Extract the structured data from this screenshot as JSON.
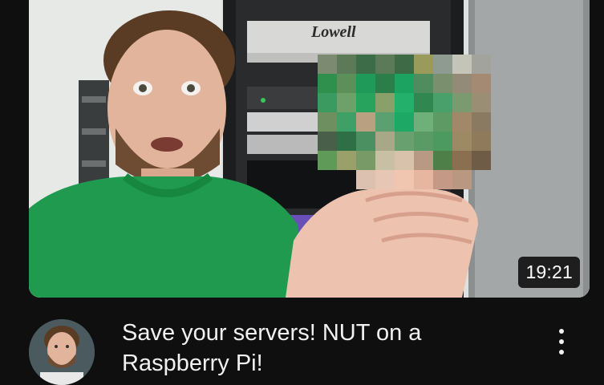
{
  "video": {
    "duration": "19:21",
    "title": "Save your servers! NUT on a Raspberry Pi!",
    "thumbnail_sign_text": "Lowell",
    "more_icon": "vertical-ellipsis-icon"
  },
  "colors": {
    "background": "#0f0f0f",
    "title_text": "#f1f1f1",
    "badge_bg": "#000000"
  }
}
